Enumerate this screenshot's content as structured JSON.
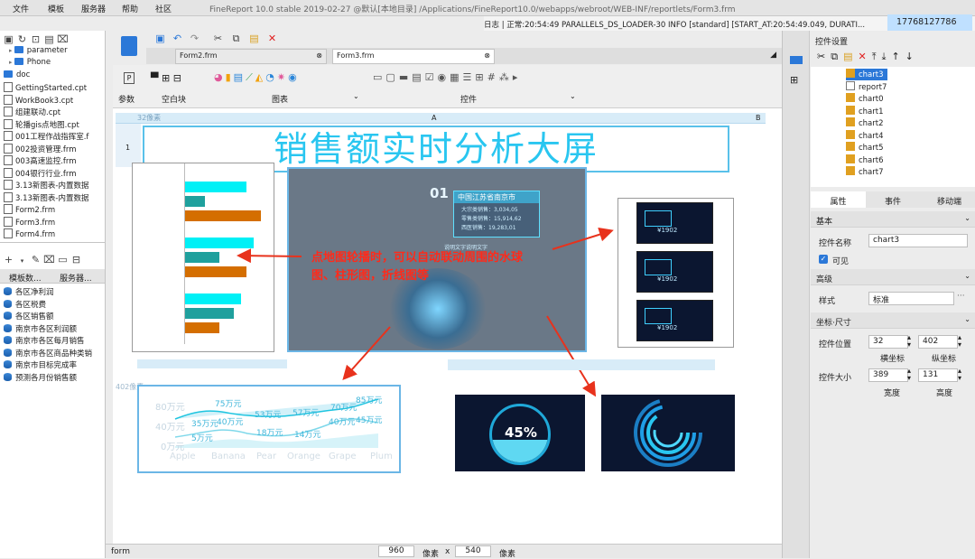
{
  "menu": {
    "items": [
      "文件",
      "模板",
      "服务器",
      "帮助",
      "社区"
    ],
    "app_title": "FineReport 10.0 stable 2019-02-27 @默认[本地目录]   /Applications/FineReport10.0/webapps/webroot/WEB-INF/reportlets/Form3.frm"
  },
  "log": {
    "text": "日志 | 正常:20:54:49 PARALLELS_DS_LOADER-30 INFO [standard] [START_AT:20:54:49.049, DURATI...",
    "user_id": "17768127786"
  },
  "left": {
    "files": [
      "parameter",
      "Phone",
      "doc",
      "GettingStarted.cpt",
      "WorkBook3.cpt",
      "组建联动.cpt",
      "轮播gis点地图.cpt",
      "001工程作战指挥室.f",
      "002投资管理.frm",
      "003高速监控.frm",
      "004银行行业.frm",
      "3.13新图表-内置数据",
      "3.13新图表-内置数据",
      "Form2.frm",
      "Form3.frm",
      "Form4.frm"
    ],
    "tabs": [
      "模板数...",
      "服务器..."
    ],
    "datasets": [
      "各区净利润",
      "各区税费",
      "各区销售额",
      "南京市各区利润额",
      "南京市各区每月销售",
      "南京市各区商品种类销",
      "南京市目标完成率",
      "预测各月份销售额"
    ]
  },
  "toolbar": {
    "tabs": [
      "Form2.frm",
      "Form3.frm"
    ],
    "groups": [
      "参数",
      "空白块",
      "图表",
      "控件"
    ]
  },
  "canvas": {
    "ruler_top": "32像素",
    "col_a": "A",
    "col_b": "B",
    "row1": "1",
    "left_ruler": "402像素",
    "title": "销售额实时分析大屏",
    "map_panel": {
      "index": "01",
      "city": "中国江苏省南京市",
      "line1": "大宗类销售：3,034,05",
      "line2": "零售类销售：15,914,62",
      "line3": "西医销售：19,283,01",
      "legend": "说明文字说明文字"
    },
    "callout": "点地图轮播时，可以自动联动周围的水球图、柱形图，折线图等",
    "mini_value": "¥1902",
    "gauge_value": "45%",
    "line": {
      "categories": [
        "Apple",
        "Banana",
        "Pear",
        "Orange",
        "Grape",
        "Plum"
      ],
      "y_labels": [
        "80万元",
        "40万元",
        "0万元"
      ],
      "labels": [
        "75万元",
        "35万元",
        "40万元",
        "53万元",
        "57万元",
        "70万元",
        "85万元",
        "5万元",
        "18万元",
        "14万元",
        "40万元",
        "45万元"
      ]
    }
  },
  "status": {
    "left": "form",
    "width": "960",
    "unit1": "像素",
    "x": "x",
    "height": "540",
    "unit2": "像素"
  },
  "right": {
    "title": "控件设置",
    "components": [
      "chart3",
      "report7",
      "chart0",
      "chart1",
      "chart2",
      "chart4",
      "chart5",
      "chart6",
      "chart7"
    ],
    "tabs": [
      "属性",
      "事件",
      "移动端"
    ],
    "sections": {
      "basic": "基本",
      "advanced": "高级",
      "coords": "坐标·尺寸"
    },
    "name_label": "控件名称",
    "name_value": "chart3",
    "visible_label": "可见",
    "style_label": "样式",
    "style_value": "标准",
    "pos_label": "控件位置",
    "pos_x": "32",
    "pos_y": "402",
    "x_caption": "横坐标",
    "y_caption": "纵坐标",
    "size_label": "控件大小",
    "width": "389",
    "height": "131",
    "w_caption": "宽度",
    "h_caption": "高度"
  },
  "colors": {
    "accent": "#2b78d8",
    "cyan": "#00f0f6",
    "teal": "#1fa09d",
    "orange": "#d46e00",
    "red": "#e8321c"
  }
}
